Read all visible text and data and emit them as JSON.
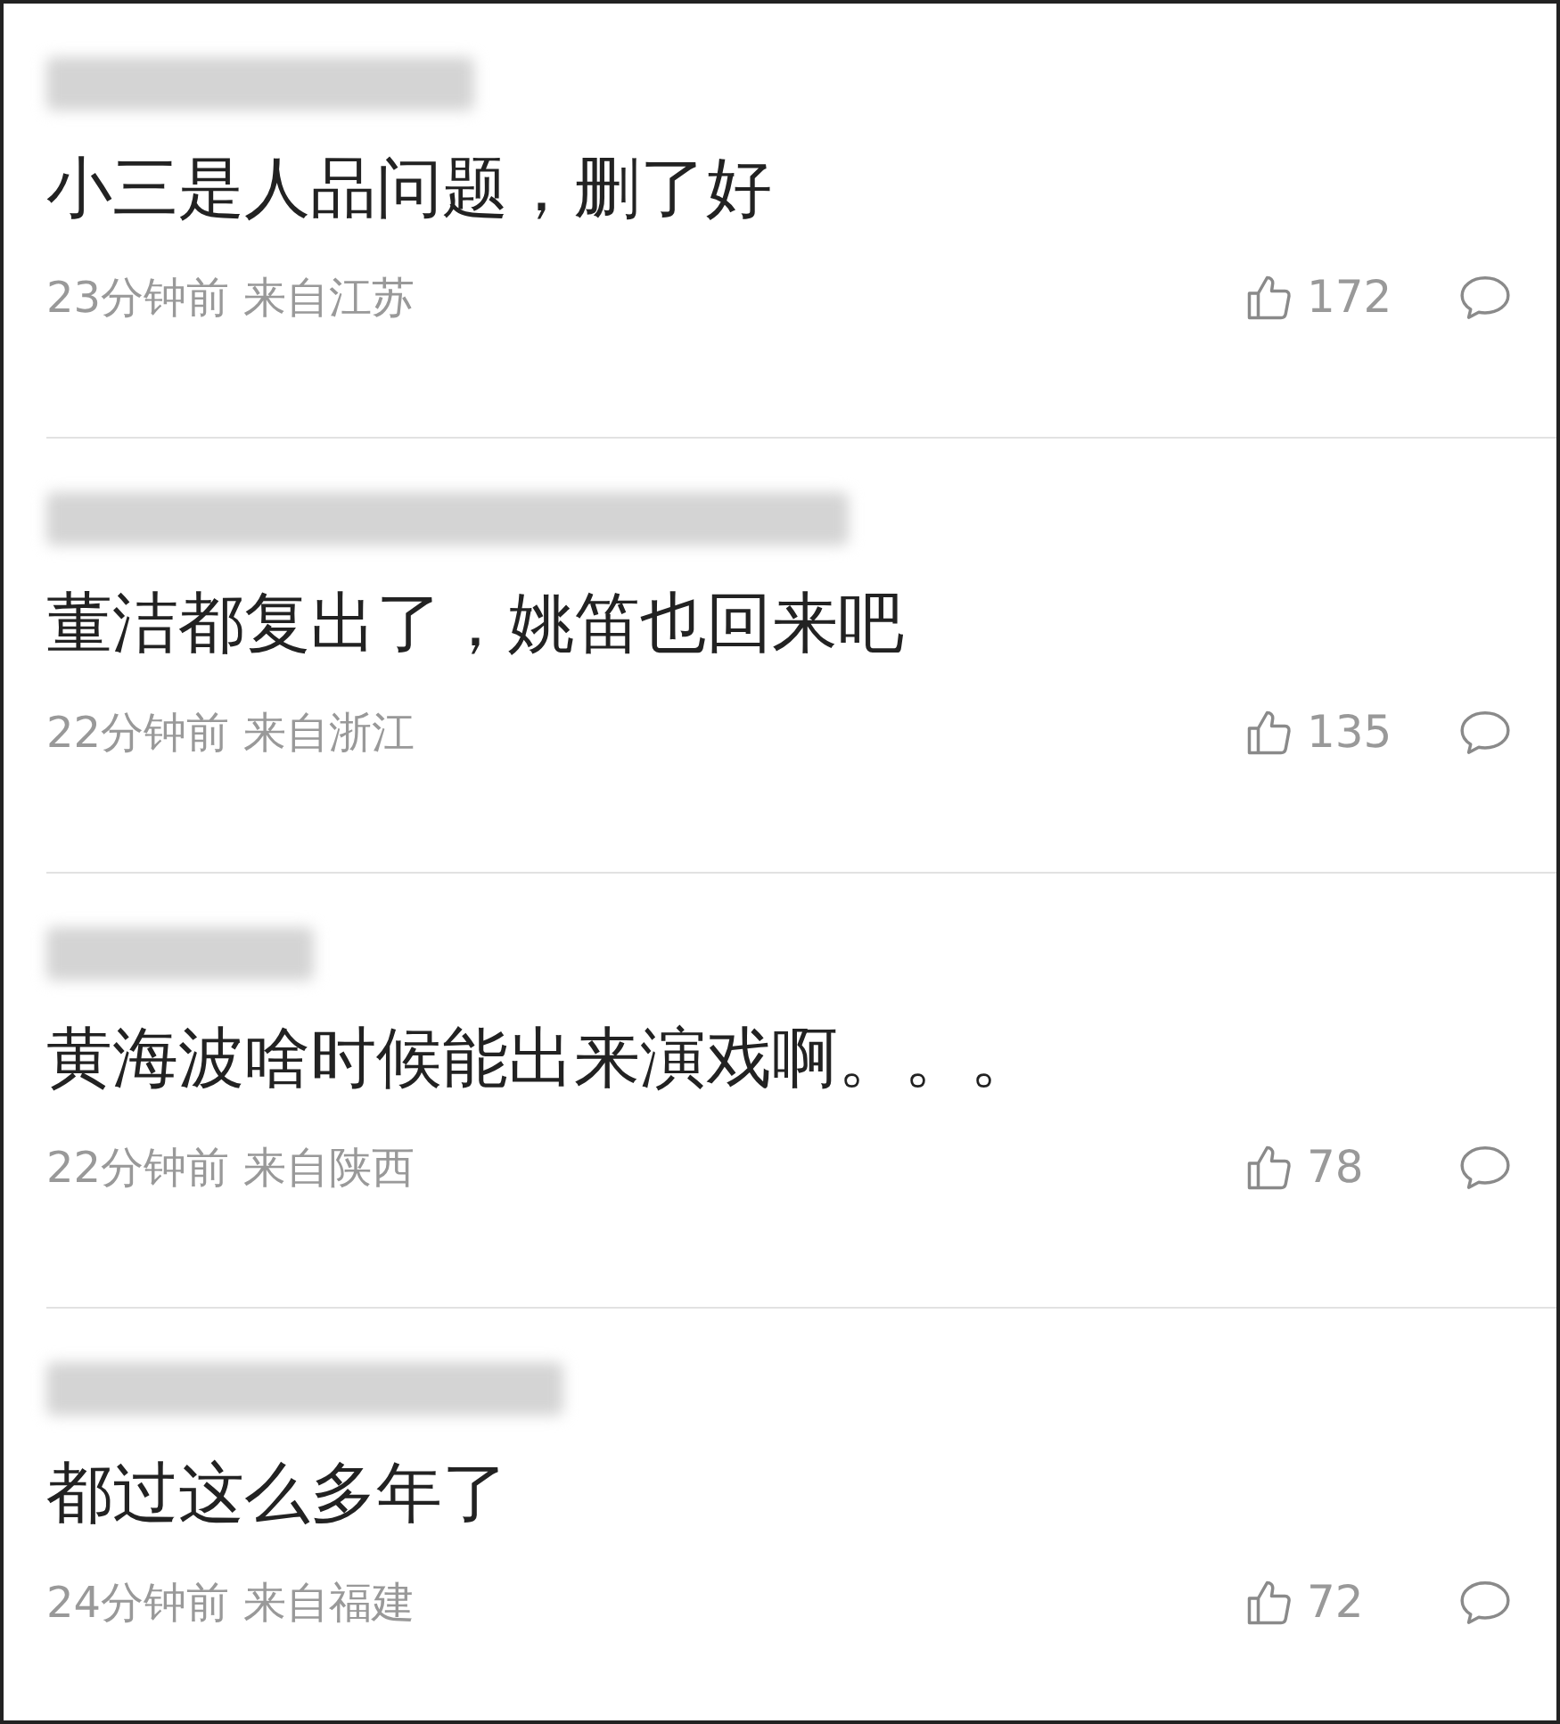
{
  "comments": [
    {
      "text": "小三是人品问题，删了好",
      "time": "23分钟前",
      "location": "来自江苏",
      "likes": "172"
    },
    {
      "text": "董洁都复出了，姚笛也回来吧",
      "time": "22分钟前",
      "location": "来自浙江",
      "likes": "135"
    },
    {
      "text": "黄海波啥时候能出来演戏啊。。。",
      "time": "22分钟前",
      "location": "来自陕西",
      "likes": "78"
    },
    {
      "text": "都过这么多年了",
      "time": "24分钟前",
      "location": "来自福建",
      "likes": "72"
    }
  ]
}
